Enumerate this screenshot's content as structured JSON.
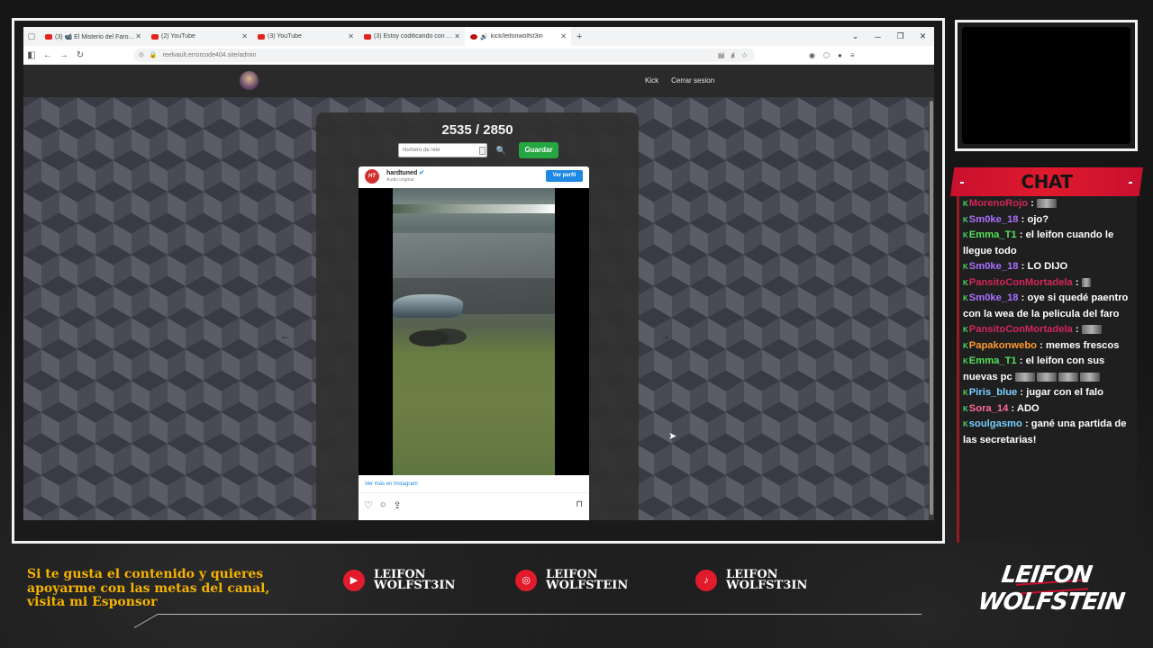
{
  "browser": {
    "tabs": [
      {
        "label": "(3) 📹 El Misterio del Faro de E",
        "type": "youtube"
      },
      {
        "label": "(2) YouTube",
        "type": "youtube"
      },
      {
        "label": "(3) YouTube",
        "type": "youtube"
      },
      {
        "label": "(3) Estoy codificando con micro",
        "type": "youtube"
      },
      {
        "label": "kick/leifonwolfst3in",
        "type": "kick",
        "active": true
      }
    ],
    "url": "reelvault.errorcode404.site/admin"
  },
  "site": {
    "nav_links": [
      "Kick",
      "Cerrar sesion"
    ],
    "counter": "2535 / 2850",
    "reel_input_placeholder": "Número de reel",
    "save_label": "Guardar"
  },
  "instagram": {
    "username": "hardtuned",
    "audio": "Audio original",
    "avatar_text": "HT",
    "profile_button": "Ver perfil",
    "more_link": "Ver más en Instagram"
  },
  "chat": {
    "title": "CHAT",
    "messages": [
      {
        "user": "MorenoRojo",
        "color": "u-red",
        "text": "",
        "emote": true
      },
      {
        "user": "Sm0ke_18",
        "color": "u-purple",
        "text": "ojo?"
      },
      {
        "user": "Emma_T1",
        "color": "u-green",
        "text": "el leifon cuando le llegue todo"
      },
      {
        "user": "Sm0ke_18",
        "color": "u-purple",
        "text": "LO DIJO"
      },
      {
        "user": "PansitoConMortadela",
        "color": "u-red",
        "text": "",
        "emote_small": true
      },
      {
        "user": "Sm0ke_18",
        "color": "u-purple",
        "text": "oye si quedé paentro con la wea de la pelicula del faro"
      },
      {
        "user": "PansitoConMortadela",
        "color": "u-red",
        "text": "",
        "emote": true
      },
      {
        "user": "Papakonwebo",
        "color": "u-orange",
        "text": "memes frescos"
      },
      {
        "user": "Emma_T1",
        "color": "u-green",
        "text": "el leifon con sus nuevas pc",
        "emotes4": true
      },
      {
        "user": "Piris_blue",
        "color": "u-blue",
        "text": "jugar con el falo"
      },
      {
        "user": "Sora_14",
        "color": "u-pink",
        "text": "ADO"
      },
      {
        "user": "soulgasmo",
        "color": "u-blue",
        "text": "gané una partida de las secretarias!"
      }
    ]
  },
  "footer": {
    "sponsor_text": "Si te gusta el contenido y quieres apoyarme con las metas del canal, visita mi Esponsor",
    "socials": [
      {
        "platform": "youtube-icon",
        "name": "LEIFON WOLFST3IN"
      },
      {
        "platform": "instagram-icon",
        "name": "LEIFON WOLFSTEIN"
      },
      {
        "platform": "tiktok-icon",
        "name": "LEIFON WOLFST3IN"
      }
    ],
    "brand_top": "LEIFON",
    "brand_bottom": "WOLFSTEIN"
  }
}
